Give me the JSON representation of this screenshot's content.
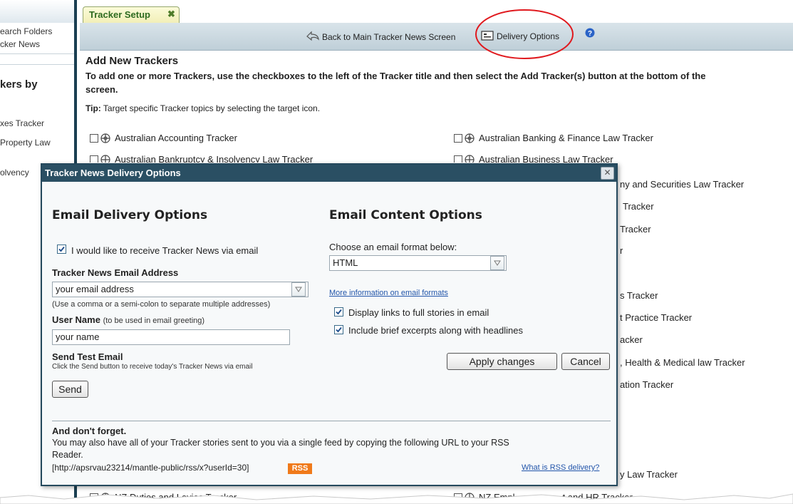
{
  "sidebar": {
    "items": [
      "earch Folders",
      "cker News"
    ],
    "heading": "kers by",
    "trackers": [
      "xes Tracker",
      "Property Law",
      "olvency"
    ]
  },
  "tab": {
    "label": "Tracker Setup",
    "close": "✖"
  },
  "toolbar": {
    "back_label": "Back to Main Tracker News Screen",
    "delivery_label": "Delivery Options",
    "help_icon": "help-icon"
  },
  "content": {
    "heading": "Add New Trackers",
    "instructions_line1": "To add one or more Trackers, use the checkboxes to the left of the Tracker title and then select the Add Tracker(s) button at the bottom of the",
    "instructions_line2": "screen.",
    "tip_label": "Tip:",
    "tip_text": "Target specific Tracker topics by selecting the target icon.",
    "left_trackers": [
      "Australian Accounting Tracker",
      "Australian Bankruptcy & Insolvency Law Tracker",
      "NZ Duties and Levies Tracker"
    ],
    "right_trackers": [
      "Australian Banking & Finance Law Tracker",
      "Australian Business Law Tracker",
      "NZ Empl",
      "t and HR Tracker"
    ],
    "right_partial": [
      "ny and Securities Law Tracker",
      "Tracker",
      "Tracker",
      "r",
      "s Tracker",
      "t Practice Tracker",
      "acker",
      ", Health & Medical law Tracker",
      "ation Tracker",
      "y Law Tracker"
    ]
  },
  "dialog": {
    "title": "Tracker News Delivery Options",
    "email_delivery": {
      "title": "Email Delivery Options",
      "receive_label": "I would like to receive Tracker News via email",
      "receive_checked": true,
      "address_label": "Tracker News Email Address",
      "address_value": "your email address",
      "address_hint": "(Use a comma or a semi-colon to separate multiple addresses)",
      "username_label": "User Name",
      "username_hint": "(to be used in email greeting)",
      "username_value": "your name",
      "test_label": "Send Test Email",
      "test_hint": "Click the Send button to receive today's Tracker News via email",
      "send_button": "Send"
    },
    "email_content": {
      "title": "Email Content Options",
      "format_label": "Choose an email format below:",
      "format_value": "HTML",
      "format_link": "More information on email formats",
      "display_links_label": "Display links to full stories in email",
      "display_links_checked": true,
      "excerpts_label": "Include brief excerpts along with headlines",
      "excerpts_checked": true,
      "apply_button": "Apply changes",
      "cancel_button": "Cancel"
    },
    "footer": {
      "title": "And don't forget.",
      "text_line1": "You may also have all of your Tracker stories sent to you via a single feed by copying the following URL to your RSS",
      "text_line2": "Reader.",
      "url": "[http://apsrvau23214/mantle-public/rss/x?userId=30]",
      "rss_badge": "RSS",
      "rss_link": "What is RSS delivery?"
    }
  },
  "colors": {
    "dialog_header": "#2a4f63",
    "highlight_circle": "#e0191e",
    "rss_badge": "#f07a1a",
    "link": "#2255aa"
  }
}
